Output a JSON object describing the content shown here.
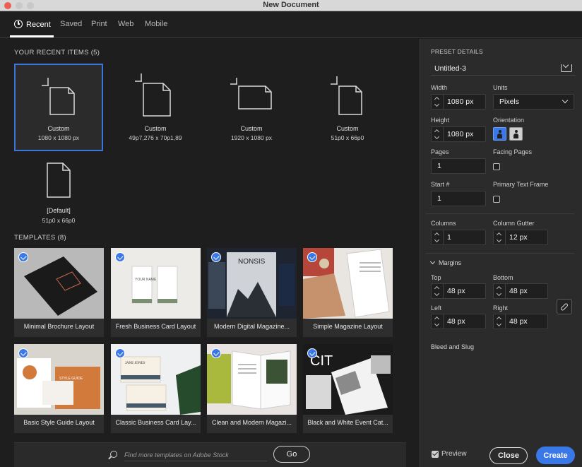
{
  "window": {
    "title": "New Document"
  },
  "tabs": [
    {
      "label": "Recent",
      "active": true,
      "icon": "clock-icon"
    },
    {
      "label": "Saved"
    },
    {
      "label": "Print"
    },
    {
      "label": "Web"
    },
    {
      "label": "Mobile"
    }
  ],
  "recent": {
    "heading": "YOUR RECENT ITEMS",
    "count": "(5)",
    "items": [
      {
        "name": "Custom",
        "size": "1080 x 1080 px",
        "selected": true,
        "icon": "document-icon"
      },
      {
        "name": "Custom",
        "size": "49p7,276 x 70p1,89",
        "icon": "document-icon"
      },
      {
        "name": "Custom",
        "size": "1920 x 1080 px",
        "icon": "document-landscape-icon"
      },
      {
        "name": "Custom",
        "size": "51p0 x 66p0",
        "icon": "document-icon"
      },
      {
        "name": "[Default]",
        "size": "51p0 x 66p0",
        "icon": "document-icon"
      }
    ]
  },
  "templates": {
    "heading": "TEMPLATES",
    "count": "(8)",
    "items": [
      {
        "label": "Minimal Brochure Layout",
        "thumb_text": ""
      },
      {
        "label": "Fresh Business Card Layout",
        "thumb_text": "YOUR NAME"
      },
      {
        "label": "Modern Digital Magazine...",
        "thumb_text": "NONSIS"
      },
      {
        "label": "Simple Magazine Layout",
        "thumb_text": ""
      },
      {
        "label": "Basic Style Guide Layout",
        "thumb_text": "STYLE GUIDE"
      },
      {
        "label": "Classic Business Card Lay...",
        "thumb_text": "JANE JONES"
      },
      {
        "label": "Clean and Modern Magazi...",
        "thumb_text": ""
      },
      {
        "label": "Black and White Event Cat...",
        "thumb_text": "CIT"
      }
    ]
  },
  "search": {
    "placeholder": "Find more templates on Adobe Stock",
    "go_label": "Go"
  },
  "preset": {
    "heading": "PRESET DETAILS",
    "name": "Untitled-3",
    "width_label": "Width",
    "width": "1080 px",
    "units_label": "Units",
    "units": "Pixels",
    "height_label": "Height",
    "height": "1080 px",
    "orientation_label": "Orientation",
    "pages_label": "Pages",
    "pages": "1",
    "facing_label": "Facing Pages",
    "start_label": "Start #",
    "start": "1",
    "primary_label": "Primary Text Frame",
    "columns_label": "Columns",
    "columns": "1",
    "gutter_label": "Column Gutter",
    "gutter": "12 px",
    "margins_label": "Margins",
    "top_label": "Top",
    "top": "48 px",
    "bottom_label": "Bottom",
    "bottom": "48 px",
    "left_label": "Left",
    "left": "48 px",
    "right_label": "Right",
    "right": "48 px",
    "bleed_label": "Bleed and Slug"
  },
  "footer": {
    "preview_label": "Preview",
    "close_label": "Close",
    "create_label": "Create"
  },
  "colors": {
    "accent": "#3b78e7",
    "bg": "#1e1e1e",
    "panel": "#2b2b2b"
  }
}
